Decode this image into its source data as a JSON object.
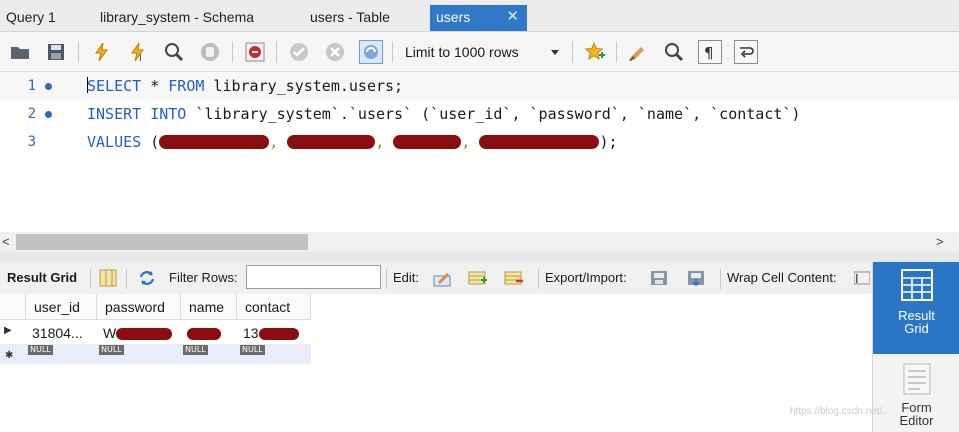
{
  "tabs": [
    {
      "label": "Query 1",
      "active": false
    },
    {
      "label": "library_system - Schema",
      "active": false
    },
    {
      "label": "users - Table",
      "active": false
    },
    {
      "label": "users",
      "active": true
    }
  ],
  "tab_close_glyph": "✕",
  "toolbar": {
    "limit_label": "Limit to 1000 rows",
    "icons": [
      "open-folder-icon",
      "save-icon",
      "execute-lightning-icon",
      "execute-current-lightning-icon",
      "explain-magnifier-icon",
      "stop-hand-icon",
      "toggle-error-stop-icon",
      "commit-check-icon",
      "rollback-x-icon",
      "autocommit-icon",
      "bookmark-star-icon",
      "beautify-broom-icon",
      "find-icon",
      "invisible-chars-icon",
      "wrap-lines-icon"
    ]
  },
  "editor": {
    "lines": [
      {
        "num": "1",
        "segments": [
          {
            "t": "SELECT",
            "c": "kw"
          },
          {
            "t": " * ",
            "c": ""
          },
          {
            "t": "FROM",
            "c": "kw"
          },
          {
            "t": " library_system.users;",
            "c": ""
          }
        ]
      },
      {
        "num": "2",
        "segments": [
          {
            "t": "INSERT INTO",
            "c": "kw"
          },
          {
            "t": " `library_system`.`users` (`user_id`, `password`, `name`, `contact`)",
            "c": ""
          }
        ]
      },
      {
        "num": "3",
        "segments": [
          {
            "t": "VALUES",
            "c": "kw"
          },
          {
            "t": " (",
            "c": ""
          }
        ],
        "tail": ");"
      }
    ]
  },
  "scroll": {
    "left_arrow": "<",
    "right_arrow": ">"
  },
  "result_toolbar": {
    "result_grid": "Result Grid",
    "filter_rows": "Filter Rows:",
    "edit": "Edit:",
    "export_import": "Export/Import:",
    "wrap_cell": "Wrap Cell Content:"
  },
  "grid": {
    "columns": [
      "user_id",
      "password",
      "name",
      "contact"
    ],
    "row": [
      "31804...",
      "W",
      "",
      "13"
    ],
    "null_label": "NULL"
  },
  "right_panel": {
    "result_grid": [
      "Result",
      "Grid"
    ],
    "form_editor": [
      "Form",
      "Editor"
    ]
  },
  "watermark": "https://blog.csdn.net/..."
}
